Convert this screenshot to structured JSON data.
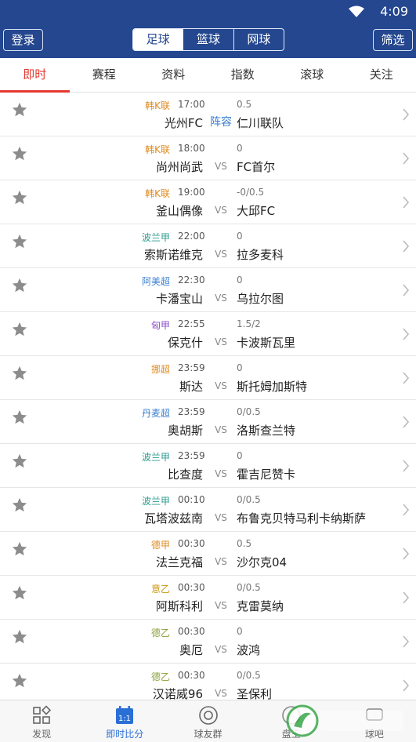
{
  "status": {
    "time": "4:09"
  },
  "header": {
    "login": "登录",
    "filter": "筛选",
    "sports": [
      "足球",
      "篮球",
      "网球"
    ]
  },
  "tabs": [
    "即时",
    "赛程",
    "资料",
    "指数",
    "滚球",
    "关注"
  ],
  "matches": [
    {
      "league": "韩K联",
      "league_color": "#e08a1e",
      "time": "17:00",
      "handicap": "0.5",
      "home": "光州FC",
      "mid": "阵容",
      "away": "仁川联队"
    },
    {
      "league": "韩K联",
      "league_color": "#e08a1e",
      "time": "18:00",
      "handicap": "0",
      "home": "尚州尚武",
      "mid": "VS",
      "away": "FC首尔"
    },
    {
      "league": "韩K联",
      "league_color": "#e08a1e",
      "time": "19:00",
      "handicap": "-0/0.5",
      "home": "釜山偶像",
      "mid": "VS",
      "away": "大邱FC"
    },
    {
      "league": "波兰甲",
      "league_color": "#2e9c8f",
      "time": "22:00",
      "handicap": "0",
      "home": "索斯诺维克",
      "mid": "VS",
      "away": "拉多麦科"
    },
    {
      "league": "阿美超",
      "league_color": "#3a7fd0",
      "time": "22:30",
      "handicap": "0",
      "home": "卡潘宝山",
      "mid": "VS",
      "away": "乌拉尔图"
    },
    {
      "league": "匈甲",
      "league_color": "#8a4fc7",
      "time": "22:55",
      "handicap": "1.5/2",
      "home": "保克什",
      "mid": "VS",
      "away": "卡波斯瓦里"
    },
    {
      "league": "挪超",
      "league_color": "#e08a1e",
      "time": "23:59",
      "handicap": "0",
      "home": "斯达",
      "mid": "VS",
      "away": "斯托姆加斯特"
    },
    {
      "league": "丹麦超",
      "league_color": "#3a7fd0",
      "time": "23:59",
      "handicap": "0/0.5",
      "home": "奥胡斯",
      "mid": "VS",
      "away": "洛斯查兰特"
    },
    {
      "league": "波兰甲",
      "league_color": "#2e9c8f",
      "time": "23:59",
      "handicap": "0",
      "home": "比查度",
      "mid": "VS",
      "away": "霍吉尼赞卡"
    },
    {
      "league": "波兰甲",
      "league_color": "#2e9c8f",
      "time": "00:10",
      "handicap": "0/0.5",
      "home": "瓦塔波兹南",
      "mid": "VS",
      "away": "布鲁克贝特马利卡纳斯萨"
    },
    {
      "league": "德甲",
      "league_color": "#e08a1e",
      "time": "00:30",
      "handicap": "0.5",
      "home": "法兰克福",
      "mid": "VS",
      "away": "沙尔克04"
    },
    {
      "league": "意乙",
      "league_color": "#c99a1a",
      "time": "00:30",
      "handicap": "0/0.5",
      "home": "阿斯科利",
      "mid": "VS",
      "away": "克雷莫纳"
    },
    {
      "league": "德乙",
      "league_color": "#8aa03a",
      "time": "00:30",
      "handicap": "0",
      "home": "奥厄",
      "mid": "VS",
      "away": "波鸿"
    },
    {
      "league": "德乙",
      "league_color": "#8aa03a",
      "time": "00:30",
      "handicap": "0/0.5",
      "home": "汉诺威96",
      "mid": "VS",
      "away": "圣保利"
    }
  ],
  "bottom_nav": [
    {
      "label": "发现",
      "icon": "grid-icon"
    },
    {
      "label": "即时比分",
      "icon": "calendar-icon"
    },
    {
      "label": "球友群",
      "icon": "ball-icon"
    },
    {
      "label": "盘王",
      "icon": "crown-icon"
    },
    {
      "label": "球吧",
      "icon": "chat-icon"
    }
  ],
  "colors": {
    "brand": "#24478f",
    "active_tab": "#e43a2f",
    "active_nav": "#2a6fd6"
  }
}
